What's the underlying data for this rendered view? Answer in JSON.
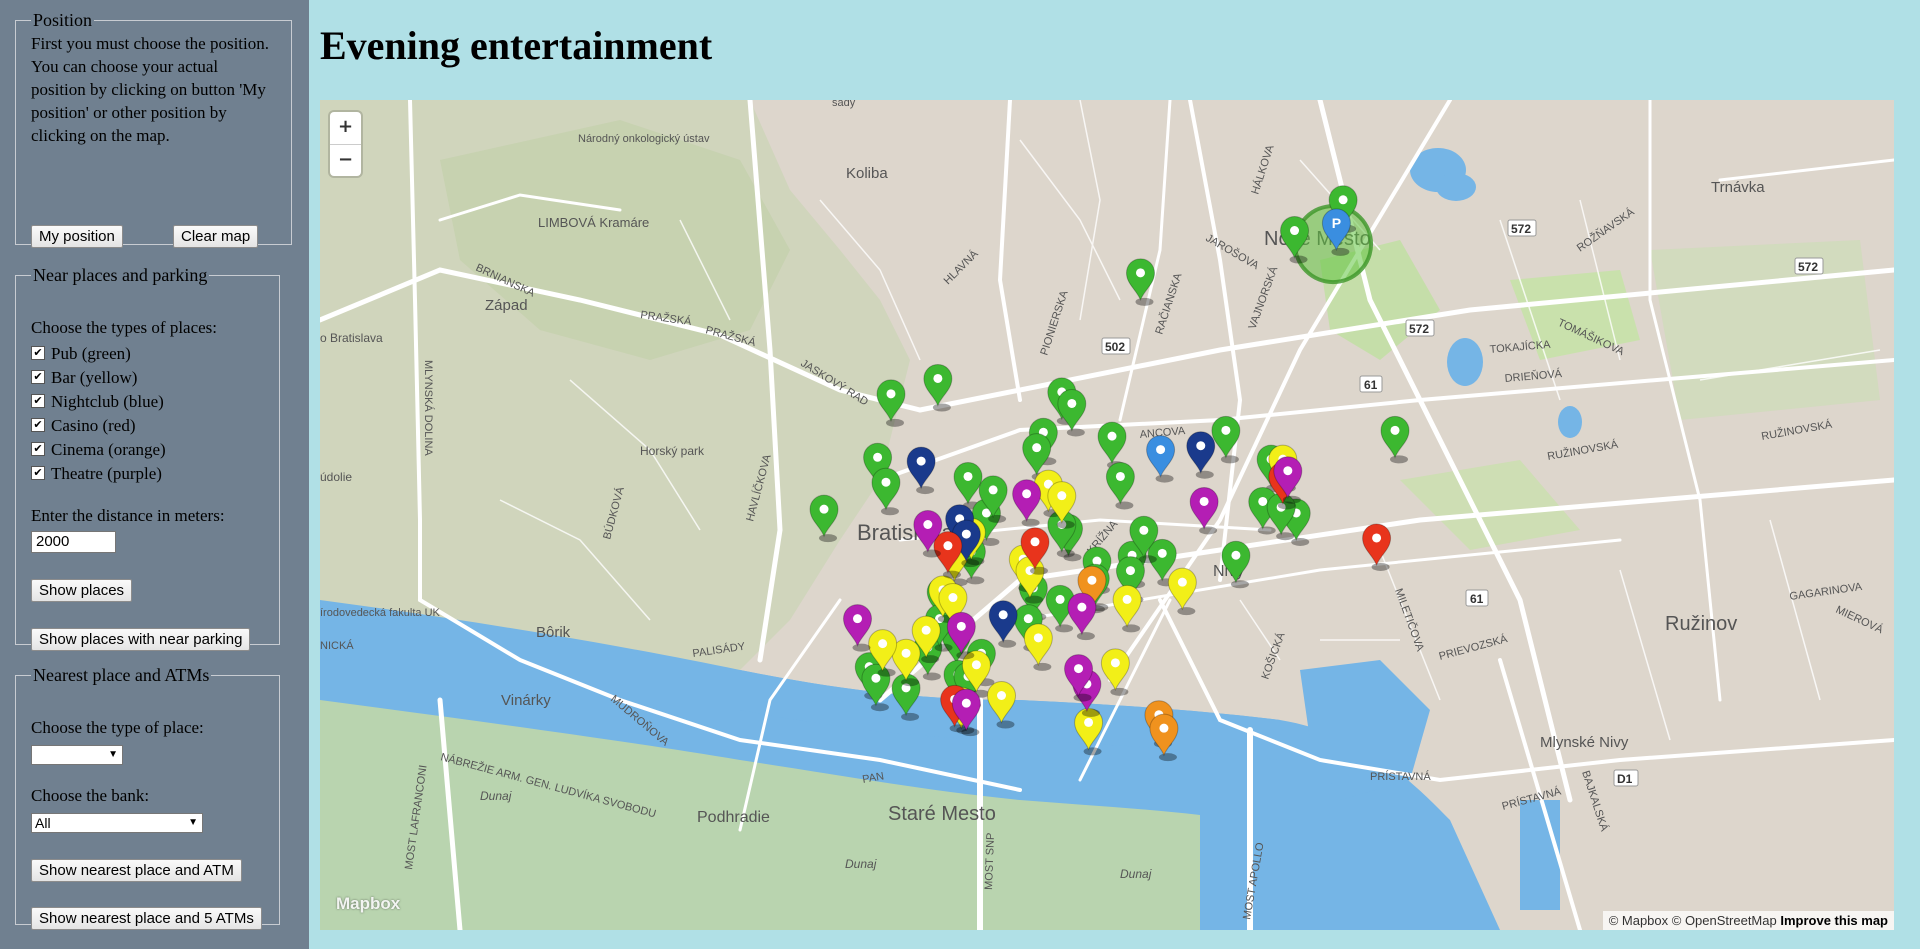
{
  "page_title": "Evening entertainment",
  "position": {
    "legend": "Position",
    "text": "First you must choose the position. You can choose your actual position by clicking on button 'My position' or other position by clicking on the map.",
    "my_position_btn": "My position",
    "clear_map_btn": "Clear map"
  },
  "near": {
    "legend": "Near places and parking",
    "types_label": "Choose the types of places:",
    "types": [
      {
        "label": "Pub (green)",
        "checked": true
      },
      {
        "label": "Bar (yellow)",
        "checked": true
      },
      {
        "label": "Nightclub (blue)",
        "checked": true
      },
      {
        "label": "Casino (red)",
        "checked": true
      },
      {
        "label": "Cinema (orange)",
        "checked": true
      },
      {
        "label": "Theatre (purple)",
        "checked": true
      }
    ],
    "distance_label": "Enter the distance in meters:",
    "distance_value": "2000",
    "show_places_btn": "Show places",
    "show_parking_btn": "Show places with near parking"
  },
  "nearest": {
    "legend": "Nearest place and ATMs",
    "type_label": "Choose the type of place:",
    "type_value": "",
    "bank_label": "Choose the bank:",
    "bank_value": "All",
    "show_atm_btn": "Show nearest place and ATM",
    "show_5atm_btn": "Show nearest place and 5 ATMs"
  },
  "map": {
    "zoom_in": "+",
    "zoom_out": "−",
    "logo": "Mapbox",
    "attribution": "© Mapbox © OpenStreetMap",
    "improve": "Improve this map",
    "colors": {
      "pub": "#3cb830",
      "bar": "#f2ef18",
      "nightclub": "#1a3a8c",
      "casino": "#e8341c",
      "cinema": "#f0921e",
      "theatre": "#b41eb4",
      "user": "#3a8ee0"
    },
    "labels": {
      "bratislava": "Bratislava",
      "nove_mesto": "Nové Mesto",
      "stare_mesto": "Staré Mesto",
      "ruzinov": "Ružinov",
      "nivy": "Nivy",
      "mlynske_nivy": "Mlynské Nivy",
      "podhradie": "Podhradie",
      "koliba": "Koliba",
      "trnavka": "Trnávka",
      "zapad": "Západ",
      "vinarky": "Vinárky",
      "borik": "Bôrik",
      "horsky_park": "Horský park",
      "kramare": "LIMBOVÁ Kramáre",
      "dunaj": "Dunaj",
      "road_572": "572",
      "road_502": "502",
      "road_61": "61",
      "road_d1": "D1",
      "narodny": "Národný onkologický ústav",
      "sady": "sady",
      "bratislava_w": "o Bratislava",
      "udolie": "údolie",
      "prirodovedecka": "írodovedecká fakulta UK",
      "nicka": "NICKÁ",
      "streets": {
        "mlynska": "MLYNSKÁ DOLINA",
        "prazska": "PRAŽSKÁ",
        "brnianska": "BRNIANSKA",
        "jaskovy": "JASKOVÝ RAD",
        "pionierska": "PIONIERSKA",
        "racianska": "RAČIANSKA",
        "halkova": "HÁLKOVA",
        "jarosova": "JAROŠOVA",
        "vajnorska": "VAJNORSKÁ",
        "roznavska": "ROŽŇAVSKÁ",
        "tomasikova": "TOMÁŠIKOVA",
        "tokajicka": "TOKAJÍCKA",
        "drienova": "DRIEŇOVÁ",
        "ruzinovska": "RUŽINOVSKÁ",
        "ruzinovska2": "RUŽINOVSKÁ",
        "gagarinova": "GAGARINOVA",
        "mierova": "MIEROVÁ",
        "prievozska": "PRIEVOZSKÁ",
        "miletica": "MILETIČOVA",
        "kosicka": "KOŠICKÁ",
        "pristavna": "PRÍSTAVNÁ",
        "pristavna2": "PRÍSTAVNÁ",
        "bajkalska": "BAJKALSKÁ",
        "most_apollo": "MOST APOLLO",
        "most_snp": "MOST SNP",
        "most_lafranconi": "MOST LAFRANCONI",
        "nabrezie": "NÁBREŽIE ARM. GEN. LUDVÍKA SVOBODU",
        "mudronova": "MUDROŇOVA",
        "palisady": "PALISÁDY",
        "havlickova": "HAVLÍČKOVA",
        "budkova": "BÚDKOVÁ",
        "hlavna": "HLAVNÁ",
        "krizna": "KRÍŽNA",
        "ancova": "ANCOVA",
        "pan": "PAN"
      }
    },
    "markers": [
      {
        "type": "pub",
        "lon": 17.143,
        "lat": 48.1618
      },
      {
        "type": "pub",
        "lon": 17.1273,
        "lat": 48.1522
      },
      {
        "type": "pub",
        "lon": 17.1278,
        "lat": 48.1509
      },
      {
        "type": "pub",
        "lon": 17.1327,
        "lat": 48.1512
      },
      {
        "type": "pub",
        "lon": 17.1309,
        "lat": 48.1563
      },
      {
        "type": "pub",
        "lon": 17.1281,
        "lat": 48.1555
      },
      {
        "type": "pub",
        "lon": 17.1383,
        "lat": 48.1556
      },
      {
        "type": "pub",
        "lon": 17.1389,
        "lat": 48.155
      },
      {
        "type": "pub",
        "lon": 17.1372,
        "lat": 48.1535
      },
      {
        "type": "pub",
        "lon": 17.1241,
        "lat": 48.1495
      },
      {
        "type": "pub",
        "lon": 17.1413,
        "lat": 48.1533
      },
      {
        "type": "pub",
        "lon": 17.1338,
        "lat": 48.1493
      },
      {
        "type": "pub",
        "lon": 17.1418,
        "lat": 48.1512
      },
      {
        "type": "pub",
        "lon": 17.1387,
        "lat": 48.1485
      },
      {
        "type": "pub",
        "lon": 17.1425,
        "lat": 48.1471
      },
      {
        "type": "pub",
        "lon": 17.1404,
        "lat": 48.1468
      },
      {
        "type": "pub",
        "lon": 17.1329,
        "lat": 48.1473
      },
      {
        "type": "pub",
        "lon": 17.1383,
        "lat": 48.1487
      },
      {
        "type": "pub",
        "lon": 17.1403,
        "lat": 48.1459
      },
      {
        "type": "pub",
        "lon": 17.1311,
        "lat": 48.1452
      },
      {
        "type": "pub",
        "lon": 17.1366,
        "lat": 48.1454
      },
      {
        "type": "pub",
        "lon": 17.1382,
        "lat": 48.1448
      },
      {
        "type": "pub",
        "lon": 17.1443,
        "lat": 48.1472
      },
      {
        "type": "pub",
        "lon": 17.1368,
        "lat": 48.1527
      },
      {
        "type": "pub",
        "lon": 17.1432,
        "lat": 48.1484
      },
      {
        "type": "pub",
        "lon": 17.1424,
        "lat": 48.1463
      },
      {
        "type": "pub",
        "lon": 17.132,
        "lat": 48.1429
      },
      {
        "type": "pub",
        "lon": 17.1303,
        "lat": 48.1423
      },
      {
        "type": "pub",
        "lon": 17.1342,
        "lat": 48.1505
      },
      {
        "type": "pub",
        "lon": 17.131,
        "lat": 48.1438
      },
      {
        "type": "pub",
        "lon": 17.1321,
        "lat": 48.1409
      },
      {
        "type": "pub",
        "lon": 17.1363,
        "lat": 48.1438
      },
      {
        "type": "pub",
        "lon": 17.1335,
        "lat": 48.142
      },
      {
        "type": "pub",
        "lon": 17.1327,
        "lat": 48.1408
      },
      {
        "type": "pub",
        "lon": 17.1268,
        "lat": 48.1413
      },
      {
        "type": "pub",
        "lon": 17.1272,
        "lat": 48.1407
      },
      {
        "type": "pub",
        "lon": 17.129,
        "lat": 48.1402
      },
      {
        "type": "pub",
        "lon": 17.1508,
        "lat": 48.1521
      },
      {
        "type": "pub",
        "lon": 17.1503,
        "lat": 48.1499
      },
      {
        "type": "pub",
        "lon": 17.1582,
        "lat": 48.1536
      },
      {
        "type": "pub",
        "lon": 17.1523,
        "lat": 48.1493
      },
      {
        "type": "pub",
        "lon": 17.1514,
        "lat": 48.1496
      },
      {
        "type": "pub",
        "lon": 17.1487,
        "lat": 48.1471
      },
      {
        "type": "pub",
        "lon": 17.1481,
        "lat": 48.1536
      },
      {
        "type": "pub",
        "lon": 17.1522,
        "lat": 48.164
      },
      {
        "type": "pub",
        "lon": 17.1551,
        "lat": 48.1656
      },
      {
        "type": "bar",
        "lon": 17.1515,
        "lat": 48.1521
      },
      {
        "type": "bar",
        "lon": 17.1375,
        "lat": 48.1508
      },
      {
        "type": "bar",
        "lon": 17.1383,
        "lat": 48.1502
      },
      {
        "type": "bar",
        "lon": 17.1329,
        "lat": 48.1483
      },
      {
        "type": "bar",
        "lon": 17.1319,
        "lat": 48.1472
      },
      {
        "type": "bar",
        "lon": 17.136,
        "lat": 48.1469
      },
      {
        "type": "bar",
        "lon": 17.1364,
        "lat": 48.1463
      },
      {
        "type": "bar",
        "lon": 17.1312,
        "lat": 48.1453
      },
      {
        "type": "bar",
        "lon": 17.1318,
        "lat": 48.1449
      },
      {
        "type": "bar",
        "lon": 17.129,
        "lat": 48.142
      },
      {
        "type": "bar",
        "lon": 17.1302,
        "lat": 48.1432
      },
      {
        "type": "bar",
        "lon": 17.1276,
        "lat": 48.1425
      },
      {
        "type": "bar",
        "lon": 17.1323,
        "lat": 48.1395
      },
      {
        "type": "bar",
        "lon": 17.1332,
        "lat": 48.1414
      },
      {
        "type": "bar",
        "lon": 17.1347,
        "lat": 48.1398
      },
      {
        "type": "bar",
        "lon": 17.1369,
        "lat": 48.1428
      },
      {
        "type": "bar",
        "lon": 17.1422,
        "lat": 48.1448
      },
      {
        "type": "bar",
        "lon": 17.1415,
        "lat": 48.1415
      },
      {
        "type": "bar",
        "lon": 17.1399,
        "lat": 48.1384
      },
      {
        "type": "bar",
        "lon": 17.1455,
        "lat": 48.1457
      },
      {
        "type": "nightclub",
        "lon": 17.1322,
        "lat": 48.149
      },
      {
        "type": "nightclub",
        "lon": 17.1326,
        "lat": 48.1482
      },
      {
        "type": "nightclub",
        "lon": 17.1299,
        "lat": 48.152
      },
      {
        "type": "nightclub",
        "lon": 17.1466,
        "lat": 48.1528
      },
      {
        "type": "nightclub",
        "lon": 17.1348,
        "lat": 48.144
      },
      {
        "type": "casino",
        "lon": 17.1315,
        "lat": 48.1476
      },
      {
        "type": "casino",
        "lon": 17.1515,
        "lat": 48.1512
      },
      {
        "type": "casino",
        "lon": 17.1571,
        "lat": 48.148
      },
      {
        "type": "casino",
        "lon": 17.1319,
        "lat": 48.1396
      },
      {
        "type": "casino",
        "lon": 17.1367,
        "lat": 48.1478
      },
      {
        "type": "cinema",
        "lon": 17.1401,
        "lat": 48.1458
      },
      {
        "type": "cinema",
        "lon": 17.1441,
        "lat": 48.1388
      },
      {
        "type": "cinema",
        "lon": 17.1444,
        "lat": 48.1381
      },
      {
        "type": "theatre",
        "lon": 17.1362,
        "lat": 48.1503
      },
      {
        "type": "theatre",
        "lon": 17.1303,
        "lat": 48.1487
      },
      {
        "type": "theatre",
        "lon": 17.1323,
        "lat": 48.1434
      },
      {
        "type": "theatre",
        "lon": 17.1326,
        "lat": 48.1394
      },
      {
        "type": "theatre",
        "lon": 17.1395,
        "lat": 48.1444
      },
      {
        "type": "theatre",
        "lon": 17.1398,
        "lat": 48.1404
      },
      {
        "type": "theatre",
        "lon": 17.1261,
        "lat": 48.1438
      },
      {
        "type": "theatre",
        "lon": 17.1468,
        "lat": 48.1499
      },
      {
        "type": "theatre",
        "lon": 17.1393,
        "lat": 48.1412
      },
      {
        "type": "theatre",
        "lon": 17.1518,
        "lat": 48.1515
      }
    ],
    "user_position": {
      "lon": 17.1442,
      "lat": 48.1526
    },
    "parking": {
      "lon": 17.1547,
      "lat": 48.1644,
      "label": "P"
    },
    "radius_center": {
      "lon": 17.1545,
      "lat": 48.1647
    }
  }
}
